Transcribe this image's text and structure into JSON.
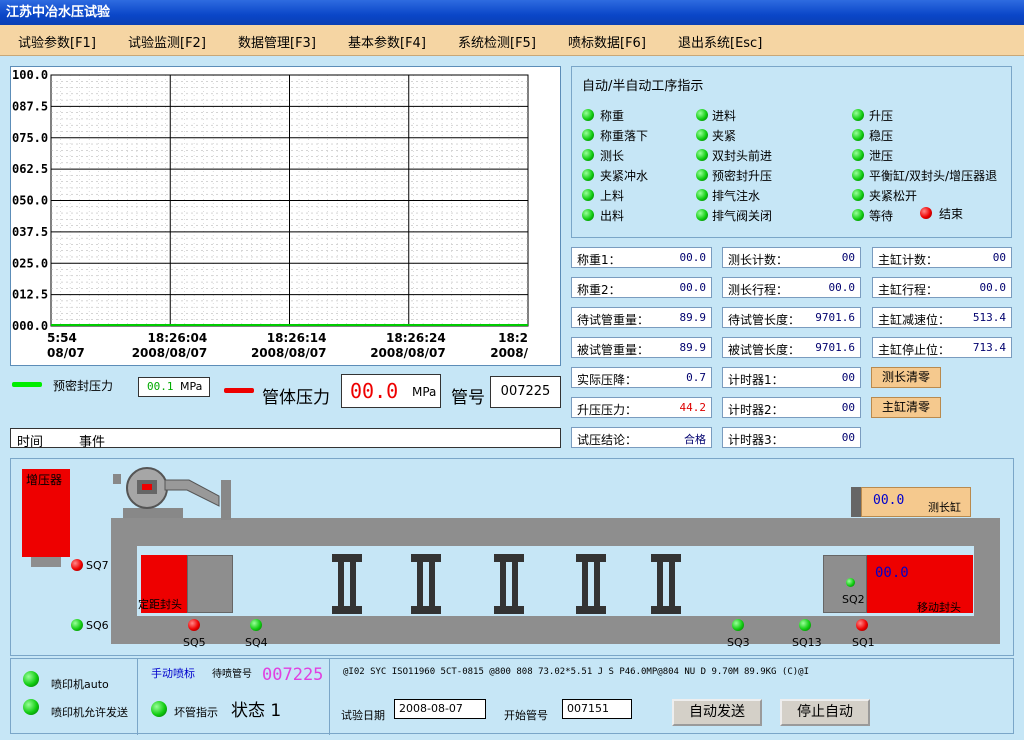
{
  "window": {
    "title": "江苏中冶水压试验"
  },
  "menu": [
    "试验参数[F1]",
    "试验监测[F2]",
    "数据管理[F3]",
    "基本参数[F4]",
    "系统检测[F5]",
    "喷标数据[F6]",
    "退出系统[Esc]"
  ],
  "chart_data": {
    "type": "line",
    "ylim": [
      0,
      100
    ],
    "y_ticks": [
      "100.0",
      "087.5",
      "075.0",
      "062.5",
      "050.0",
      "037.5",
      "025.0",
      "012.5",
      "000.0"
    ],
    "x_ticks": [
      {
        "time": "5:54",
        "date": "08/07"
      },
      {
        "time": "18:26:04",
        "date": "2008/08/07"
      },
      {
        "time": "18:26:14",
        "date": "2008/08/07"
      },
      {
        "time": "18:26:24",
        "date": "2008/08/07"
      },
      {
        "time": "18:2",
        "date": "2008/"
      }
    ],
    "series": [
      {
        "color": "#00cc00",
        "values": [
          0,
          0,
          0,
          0,
          0
        ]
      }
    ],
    "grid": true
  },
  "legend": {
    "seal_label": "预密封压力",
    "seal_value": "00.1",
    "seal_unit": "MPa",
    "pipe_label": "管体压力",
    "pipe_value": "00.0",
    "pipe_unit": "MPa",
    "tube_label": "管号",
    "tube_value": "007225"
  },
  "events": {
    "time_header": "时间",
    "event_header": "事件"
  },
  "sequence": {
    "title": "自动/半自动工序指示",
    "col1": [
      "称重",
      "称重落下",
      "测长",
      "夹紧冲水",
      "上料",
      "出料"
    ],
    "col2": [
      "进料",
      "夹紧",
      "双封头前进",
      "预密封升压",
      "排气注水",
      "排气阀关闭"
    ],
    "col3": [
      "升压",
      "稳压",
      "泄压",
      "平衡缸/双封头/增压器退",
      "夹紧松开",
      "等待"
    ],
    "end_label": "结束"
  },
  "fields": {
    "c1": [
      {
        "label": "称重1：",
        "value": "00.0"
      },
      {
        "label": "称重2：",
        "value": "00.0"
      },
      {
        "label": "待试管重量：",
        "value": "89.9"
      },
      {
        "label": "被试管重量：",
        "value": "89.9"
      },
      {
        "label": "实际压降：",
        "value": "0.7"
      },
      {
        "label": "升压压力：",
        "value": "44.2"
      },
      {
        "label": "试压结论：",
        "value": "合格"
      }
    ],
    "c2": [
      {
        "label": "测长计数：",
        "value": "00"
      },
      {
        "label": "测长行程：",
        "value": "00.0"
      },
      {
        "label": "待试管长度：",
        "value": "9701.6"
      },
      {
        "label": "被试管长度：",
        "value": "9701.6"
      },
      {
        "label": "计时器1：",
        "value": "00"
      },
      {
        "label": "计时器2：",
        "value": "00"
      },
      {
        "label": "计时器3：",
        "value": "00"
      }
    ],
    "c3": [
      {
        "label": "主缸计数：",
        "value": "00"
      },
      {
        "label": "主缸行程：",
        "value": "00.0"
      },
      {
        "label": "主缸减速位：",
        "value": "513.4"
      },
      {
        "label": "主缸停止位：",
        "value": "713.4"
      }
    ],
    "btn_measure_reset": "测长清零",
    "btn_main_reset": "主缸清零"
  },
  "machine": {
    "booster": "增压器",
    "fixed_head": "定距封头",
    "moving_head": "移动封头",
    "moving_value": "00.0",
    "measure_cyl": "测长缸",
    "measure_value": "00.0",
    "sq": [
      "SQ7",
      "SQ6",
      "SQ5",
      "SQ4",
      "SQ3",
      "SQ13",
      "SQ1",
      "SQ2"
    ]
  },
  "footer": {
    "printer_auto": "喷印机auto",
    "printer_allow": "喷印机允许发送",
    "manual_spray": "手动喷标",
    "waiting_label": "待喷管号",
    "waiting_value": "007225",
    "bad_pipe": "坏管指示",
    "status": "状态 1",
    "spray_text": "@I02 SYC ISO11960 5CT-0815 @800 808 73.02*5.51 J S P46.0MP@804 NU D 9.70M 89.9KG (C)@I",
    "date_label": "试验日期",
    "date_value": "2008-08-07",
    "start_label": "开始管号",
    "start_value": "007151",
    "btn_auto_send": "自动发送",
    "btn_stop_auto": "停止自动"
  }
}
